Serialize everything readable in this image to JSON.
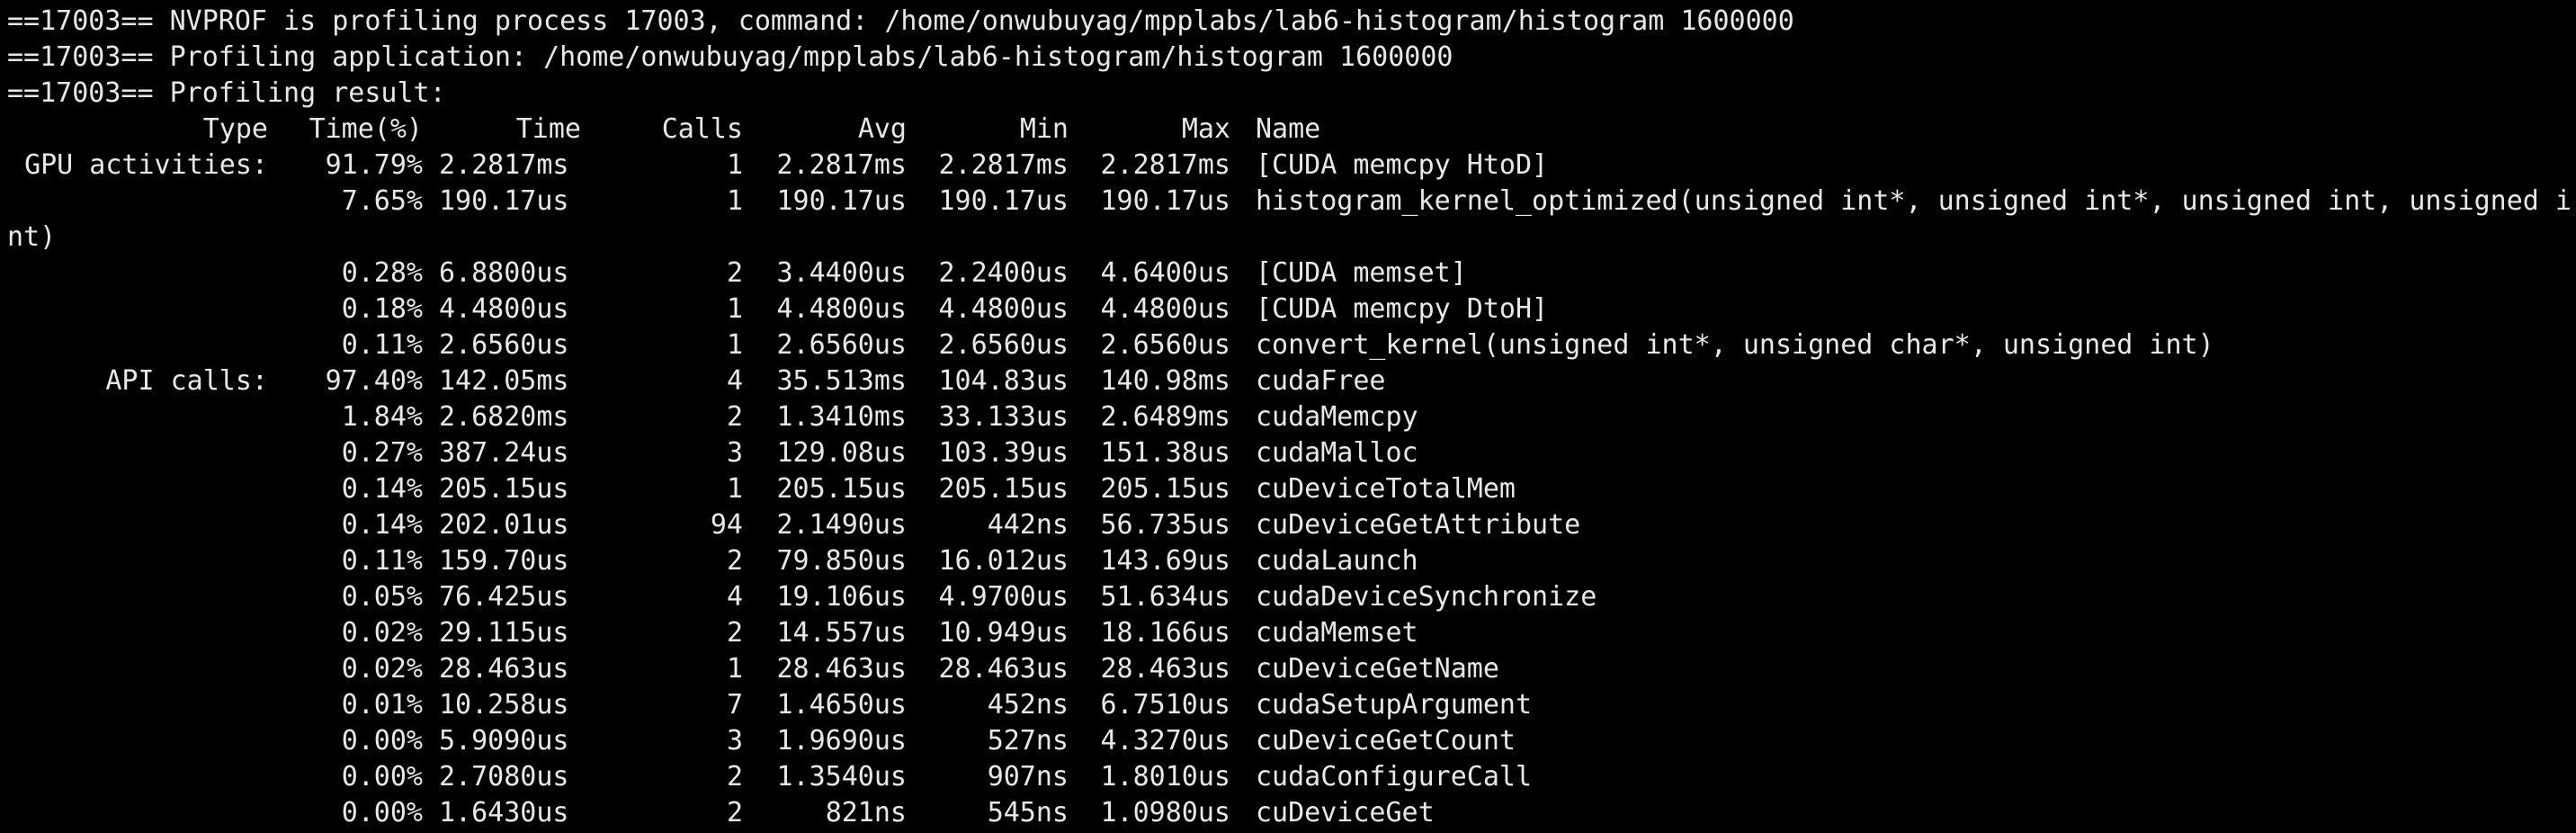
{
  "colors": {
    "background": "#000000",
    "text": "#e8e8e8"
  },
  "header_lines": [
    "==17003== NVPROF is profiling process 17003, command: /home/onwubuyag/mpplabs/lab6-histogram/histogram 1600000",
    "==17003== Profiling application: /home/onwubuyag/mpplabs/lab6-histogram/histogram 1600000",
    "==17003== Profiling result:"
  ],
  "columns": {
    "type": "Type",
    "pct": "Time(%)",
    "time": "Time",
    "calls": "Calls",
    "avg": "Avg",
    "min": "Min",
    "max": "Max",
    "name": "Name"
  },
  "gpu_rows": [
    {
      "type": "GPU activities:",
      "pct": "91.79%",
      "time": "2.2817ms",
      "calls": "1",
      "avg": "2.2817ms",
      "min": "2.2817ms",
      "max": "2.2817ms",
      "name": "[CUDA memcpy HtoD]"
    },
    {
      "type": "",
      "pct": "7.65%",
      "time": "190.17us",
      "calls": "1",
      "avg": "190.17us",
      "min": "190.17us",
      "max": "190.17us",
      "name": "histogram_kernel_optimized(unsigned int*, unsigned int*, unsigned int, unsigned i",
      "wrap": "nt)"
    },
    {
      "type": "",
      "pct": "0.28%",
      "time": "6.8800us",
      "calls": "2",
      "avg": "3.4400us",
      "min": "2.2400us",
      "max": "4.6400us",
      "name": "[CUDA memset]"
    },
    {
      "type": "",
      "pct": "0.18%",
      "time": "4.4800us",
      "calls": "1",
      "avg": "4.4800us",
      "min": "4.4800us",
      "max": "4.4800us",
      "name": "[CUDA memcpy DtoH]"
    },
    {
      "type": "",
      "pct": "0.11%",
      "time": "2.6560us",
      "calls": "1",
      "avg": "2.6560us",
      "min": "2.6560us",
      "max": "2.6560us",
      "name": "convert_kernel(unsigned int*, unsigned char*, unsigned int)"
    }
  ],
  "api_rows": [
    {
      "type": "API calls:",
      "pct": "97.40%",
      "time": "142.05ms",
      "calls": "4",
      "avg": "35.513ms",
      "min": "104.83us",
      "max": "140.98ms",
      "name": "cudaFree"
    },
    {
      "type": "",
      "pct": "1.84%",
      "time": "2.6820ms",
      "calls": "2",
      "avg": "1.3410ms",
      "min": "33.133us",
      "max": "2.6489ms",
      "name": "cudaMemcpy"
    },
    {
      "type": "",
      "pct": "0.27%",
      "time": "387.24us",
      "calls": "3",
      "avg": "129.08us",
      "min": "103.39us",
      "max": "151.38us",
      "name": "cudaMalloc"
    },
    {
      "type": "",
      "pct": "0.14%",
      "time": "205.15us",
      "calls": "1",
      "avg": "205.15us",
      "min": "205.15us",
      "max": "205.15us",
      "name": "cuDeviceTotalMem"
    },
    {
      "type": "",
      "pct": "0.14%",
      "time": "202.01us",
      "calls": "94",
      "avg": "2.1490us",
      "min": "442ns",
      "max": "56.735us",
      "name": "cuDeviceGetAttribute"
    },
    {
      "type": "",
      "pct": "0.11%",
      "time": "159.70us",
      "calls": "2",
      "avg": "79.850us",
      "min": "16.012us",
      "max": "143.69us",
      "name": "cudaLaunch"
    },
    {
      "type": "",
      "pct": "0.05%",
      "time": "76.425us",
      "calls": "4",
      "avg": "19.106us",
      "min": "4.9700us",
      "max": "51.634us",
      "name": "cudaDeviceSynchronize"
    },
    {
      "type": "",
      "pct": "0.02%",
      "time": "29.115us",
      "calls": "2",
      "avg": "14.557us",
      "min": "10.949us",
      "max": "18.166us",
      "name": "cudaMemset"
    },
    {
      "type": "",
      "pct": "0.02%",
      "time": "28.463us",
      "calls": "1",
      "avg": "28.463us",
      "min": "28.463us",
      "max": "28.463us",
      "name": "cuDeviceGetName"
    },
    {
      "type": "",
      "pct": "0.01%",
      "time": "10.258us",
      "calls": "7",
      "avg": "1.4650us",
      "min": "452ns",
      "max": "6.7510us",
      "name": "cudaSetupArgument"
    },
    {
      "type": "",
      "pct": "0.00%",
      "time": "5.9090us",
      "calls": "3",
      "avg": "1.9690us",
      "min": "527ns",
      "max": "4.3270us",
      "name": "cuDeviceGetCount"
    },
    {
      "type": "",
      "pct": "0.00%",
      "time": "2.7080us",
      "calls": "2",
      "avg": "1.3540us",
      "min": "907ns",
      "max": "1.8010us",
      "name": "cudaConfigureCall"
    },
    {
      "type": "",
      "pct": "0.00%",
      "time": "1.6430us",
      "calls": "2",
      "avg": "821ns",
      "min": "545ns",
      "max": "1.0980us",
      "name": "cuDeviceGet"
    }
  ]
}
